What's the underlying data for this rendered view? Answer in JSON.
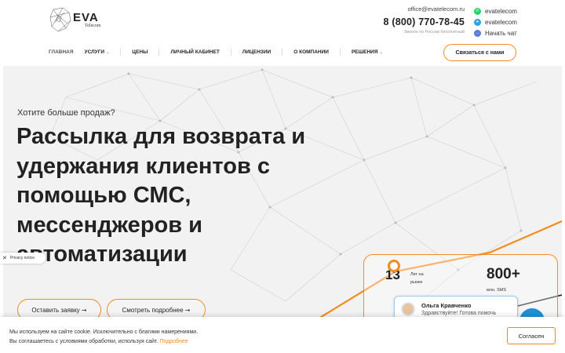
{
  "header": {
    "logo_text": "EVA",
    "logo_sub": "Telecom",
    "email": "office@evatelecom.ru",
    "phone": "8 (800) 770-78-45",
    "phone_note": "Звонок по России бесплатный",
    "socials": [
      {
        "label": "evatelecom",
        "icon": "whatsapp-icon",
        "color": "#25d366"
      },
      {
        "label": "evatelecom",
        "icon": "telegram-icon",
        "color": "#2aa3df"
      },
      {
        "label": "Начать чат",
        "icon": "chat-icon",
        "color": "#5b7bd5"
      }
    ],
    "nav": [
      {
        "label": "ГЛАВНАЯ",
        "active": true
      },
      {
        "label": "УСЛУГИ",
        "dropdown": true
      },
      {
        "label": "ЦЕНЫ"
      },
      {
        "label": "ЛИЧНЫЙ КАБИНЕТ"
      },
      {
        "label": "ЛИЦЕНЗИИ"
      },
      {
        "label": "О КОМПАНИИ"
      },
      {
        "label": "РЕШЕНИЯ",
        "dropdown": true
      }
    ],
    "cta_label": "Связаться с нами"
  },
  "hero": {
    "eyebrow": "Хотите больше продаж?",
    "headline": "Рассылка для возврата и удержания клиентов с помощью СМС, мессенджеров и автоматизации",
    "btn_primary": "Оставить заявку ➞",
    "btn_secondary": "Смотреть подробнее ➞",
    "stats": [
      {
        "value": "13",
        "label": "Лет на рынке"
      },
      {
        "value": "800+",
        "label": "млн. SMS"
      }
    ]
  },
  "privacy": {
    "label": "Privacy notice"
  },
  "chat": {
    "name": "Ольга Кравченко",
    "message": "Здравствуйте! Готова помочь"
  },
  "cookie": {
    "line1": "Мы используем на сайте cookie. Исключительно с благими намерениями.",
    "line2": "Вы соглашаетесь с условиями обработки, используя сайт.",
    "link": "Подробнее",
    "accept": "Согласен"
  },
  "colors": {
    "accent": "#f28c1e",
    "chat_blue": "#1e90d6"
  }
}
